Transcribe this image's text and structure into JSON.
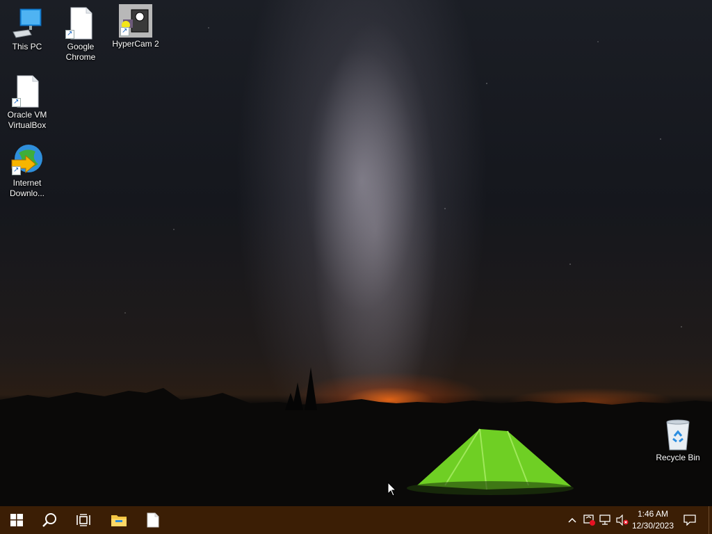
{
  "desktop": {
    "wallpaper": "night-sky-milky-way-tent",
    "icons": [
      {
        "label": "This PC",
        "icon": "computer-icon"
      },
      {
        "label": "Google Chrome",
        "icon": "blank-file-icon"
      },
      {
        "label": "HyperCam 2",
        "icon": "hypercam-icon"
      },
      {
        "label": "Oracle VM VirtualBox",
        "icon": "blank-file-icon"
      },
      {
        "label": "Internet Downlo...",
        "icon": "internet-download-manager-icon"
      },
      {
        "label": "Recycle Bin",
        "icon": "recycle-bin-icon"
      }
    ]
  },
  "taskbar": {
    "background_color": "#3b1e05",
    "buttons": [
      {
        "name": "start",
        "icon": "windows-logo-icon"
      },
      {
        "name": "search",
        "icon": "search-icon"
      },
      {
        "name": "task-view",
        "icon": "task-view-icon"
      },
      {
        "name": "file-explorer",
        "icon": "folder-icon"
      },
      {
        "name": "pinned-file",
        "icon": "blank-file-icon"
      }
    ],
    "tray": {
      "icons": [
        "chevron-up-icon",
        "security-warning-icon",
        "network-icon",
        "volume-muted-icon"
      ],
      "time": "1:46 AM",
      "date": "12/30/2023",
      "notification_icon": "action-center-icon"
    }
  }
}
